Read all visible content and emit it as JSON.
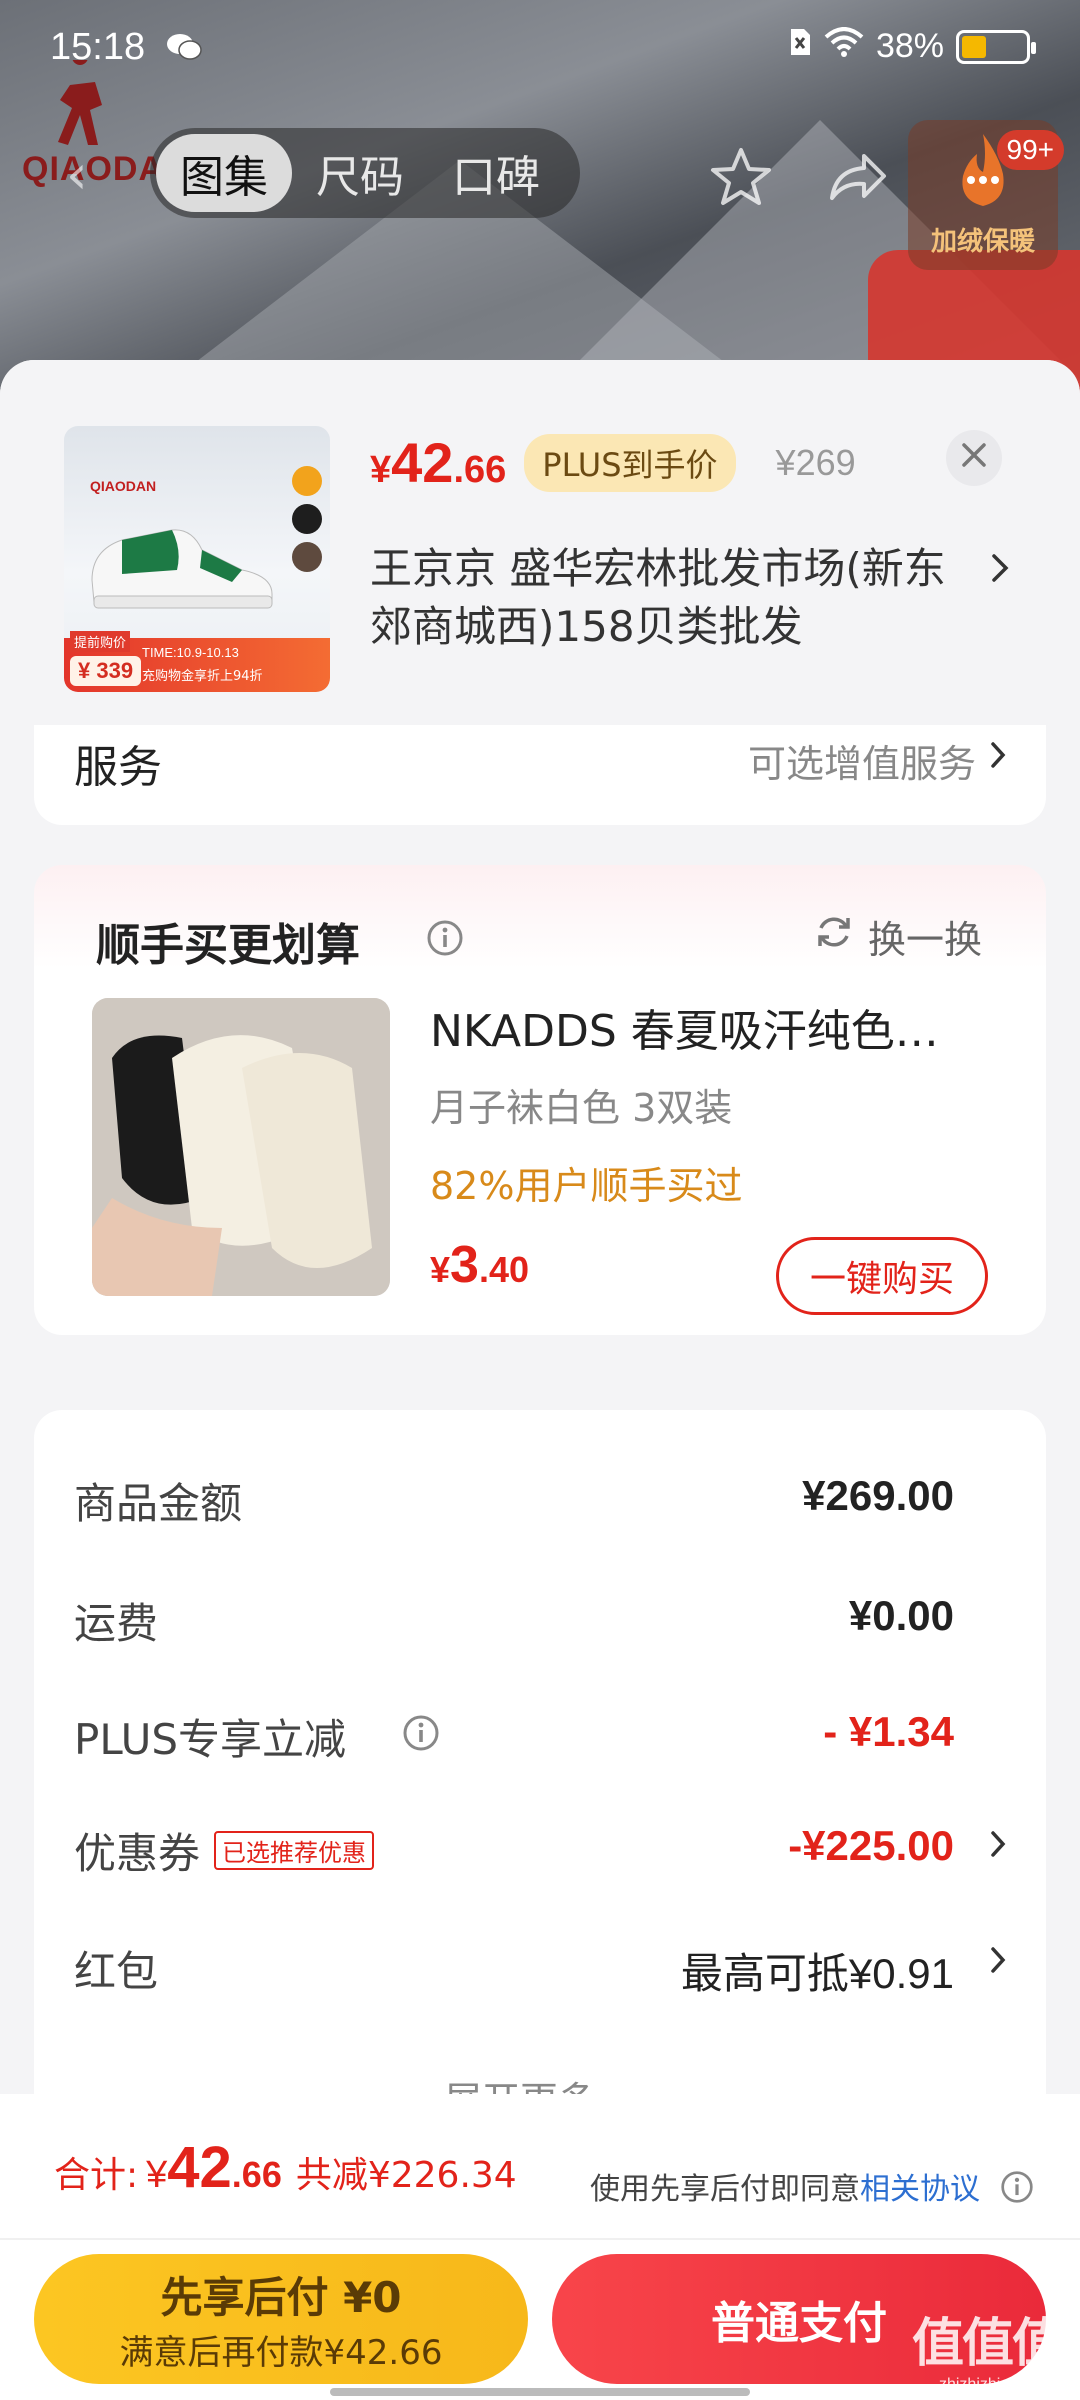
{
  "status_bar": {
    "time": "15:18",
    "battery": "38%",
    "battery_level": 0.38
  },
  "background": {
    "brand_logo": "QIAODAN",
    "tabs": [
      "图集",
      "尺码",
      "口碑"
    ],
    "active_tab": 0,
    "hot_badge": "99+",
    "hot_label": "加绒保暖"
  },
  "product": {
    "price_currency": "¥",
    "price_int": "42",
    "price_dec": ".66",
    "plus_tag": "PLUS到手价",
    "original_price": "¥269",
    "address": "王京京  盛华宏林批发市场(新东郊商城西)158贝类批发",
    "thumb": {
      "brand": "QIAODAN",
      "tag": "提前购价",
      "price": "¥ 339",
      "time": "TIME:10.9-10.13",
      "note": "充购物金享折上94折"
    }
  },
  "service": {
    "label": "服务",
    "value": "可选增值服务"
  },
  "upsell": {
    "title": "顺手买更划算",
    "swap_label": "换一换",
    "product_name": "NKADDS 春夏吸汗纯色…",
    "spec": "月子袜白色   3双装",
    "bought": "82%用户顺手买过",
    "price_currency": "¥",
    "price_int": "3",
    "price_dec": ".40",
    "buy_label": "一键购买"
  },
  "summary": {
    "rows": [
      {
        "label": "商品金额",
        "value": "¥269.00"
      },
      {
        "label": "运费",
        "value": "¥0.00"
      },
      {
        "label": "PLUS专享立减",
        "value": "- ¥1.34"
      },
      {
        "label": "优惠券",
        "tag": "已选推荐优惠",
        "value": "-¥225.00"
      },
      {
        "label": "红包",
        "value": "最高可抵¥0.91"
      }
    ],
    "expand": "展开更多"
  },
  "footer": {
    "total_label": "合计:",
    "total_currency": "¥",
    "total_int": "42",
    "total_dec": ".66",
    "saved": "共减¥226.34",
    "agree_text": "使用先享后付即同意",
    "agree_link": "相关协议",
    "credit_line1": "先享后付 ¥0",
    "credit_line2": "满意后再付款¥42.66",
    "pay_label": "普通支付"
  },
  "watermark": {
    "line1": "值值值",
    "line2": "zhizhizhi.com"
  },
  "colors": {
    "accent_red": "#e2231a",
    "plus_gold": "#fbe7b4",
    "credit_yellow": "#fcc622",
    "link_blue": "#2d6fd1"
  }
}
